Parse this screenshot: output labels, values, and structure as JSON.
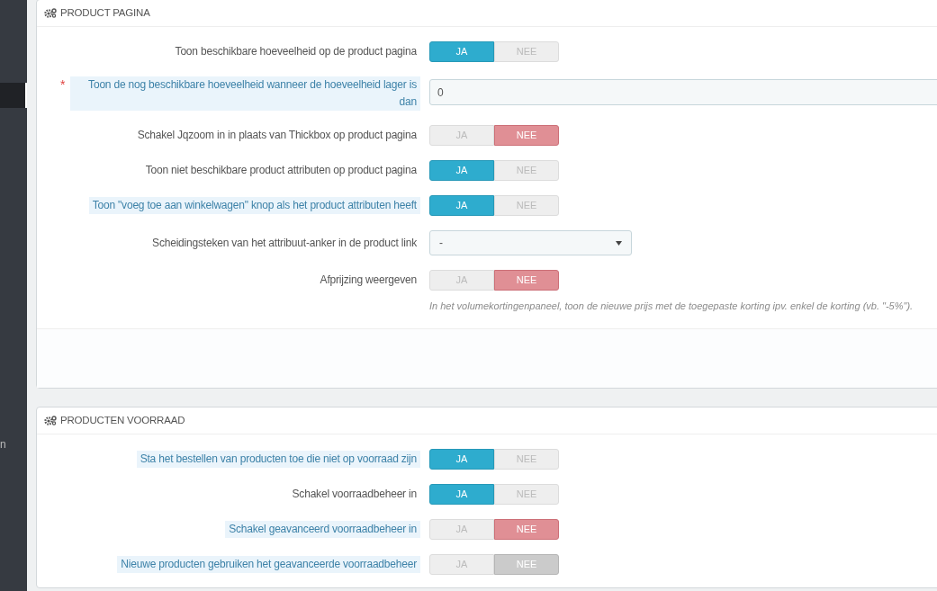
{
  "sidebar": {
    "items": [
      {
        "selected": true
      },
      {
        "label": "n",
        "selected": false
      }
    ]
  },
  "sections": [
    {
      "title": "PRODUCT PAGINA",
      "footer": true,
      "rows": [
        {
          "kind": "toggle",
          "label": "Toon beschikbare hoeveelheid op de product pagina",
          "highlighted": false,
          "disabled": false,
          "options": [
            {
              "label": "JA",
              "selected": true
            },
            {
              "label": "NEE",
              "selected": false
            }
          ]
        },
        {
          "kind": "input",
          "label": "Toon de nog beschikbare hoeveelheid wanneer de hoeveelheid lager is dan",
          "highlighted": true,
          "required_mark": "*",
          "disabled": false,
          "value": "0"
        },
        {
          "kind": "toggle",
          "label": "Schakel Jqzoom in in plaats van Thickbox op product pagina",
          "highlighted": false,
          "disabled": false,
          "options": [
            {
              "label": "JA",
              "selected": false
            },
            {
              "label": "NEE",
              "selected": true
            }
          ]
        },
        {
          "kind": "toggle",
          "label": "Toon niet beschikbare product attributen op product pagina",
          "highlighted": false,
          "disabled": false,
          "options": [
            {
              "label": "JA",
              "selected": true
            },
            {
              "label": "NEE",
              "selected": false
            }
          ]
        },
        {
          "kind": "toggle",
          "label": "Toon \"voeg toe aan winkelwagen\" knop als het product attributen heeft",
          "highlighted": true,
          "disabled": false,
          "options": [
            {
              "label": "JA",
              "selected": true
            },
            {
              "label": "NEE",
              "selected": false
            }
          ]
        },
        {
          "kind": "select",
          "label": "Scheidingsteken van het attribuut-anker in de product link",
          "highlighted": false,
          "disabled": false,
          "value": "-"
        },
        {
          "kind": "toggle",
          "label": "Afprijzing weergeven",
          "highlighted": false,
          "disabled": false,
          "options": [
            {
              "label": "JA",
              "selected": false
            },
            {
              "label": "NEE",
              "selected": true
            }
          ],
          "help": "In het volumekortingenpaneel, toon de nieuwe prijs met de toegepaste korting ipv. enkel de korting (vb. \"-5%\")."
        }
      ]
    },
    {
      "title": "PRODUCTEN VOORRAAD",
      "footer": false,
      "rows": [
        {
          "kind": "toggle",
          "label": "Sta het bestellen van producten toe die niet op voorraad zijn",
          "highlighted": true,
          "disabled": false,
          "options": [
            {
              "label": "JA",
              "selected": true
            },
            {
              "label": "NEE",
              "selected": false
            }
          ]
        },
        {
          "kind": "toggle",
          "label": "Schakel voorraadbeheer in",
          "highlighted": false,
          "disabled": false,
          "options": [
            {
              "label": "JA",
              "selected": true
            },
            {
              "label": "NEE",
              "selected": false
            }
          ]
        },
        {
          "kind": "toggle",
          "label": "Schakel geavanceerd voorraadbeheer in",
          "highlighted": true,
          "disabled": false,
          "options": [
            {
              "label": "JA",
              "selected": false
            },
            {
              "label": "NEE",
              "selected": true
            }
          ]
        },
        {
          "kind": "toggle",
          "label": "Nieuwe producten gebruiken het geavanceerde voorraadbeheer",
          "highlighted": true,
          "disabled": true,
          "options": [
            {
              "label": "JA",
              "selected": false
            },
            {
              "label": "NEE",
              "selected": true
            }
          ]
        }
      ]
    }
  ]
}
